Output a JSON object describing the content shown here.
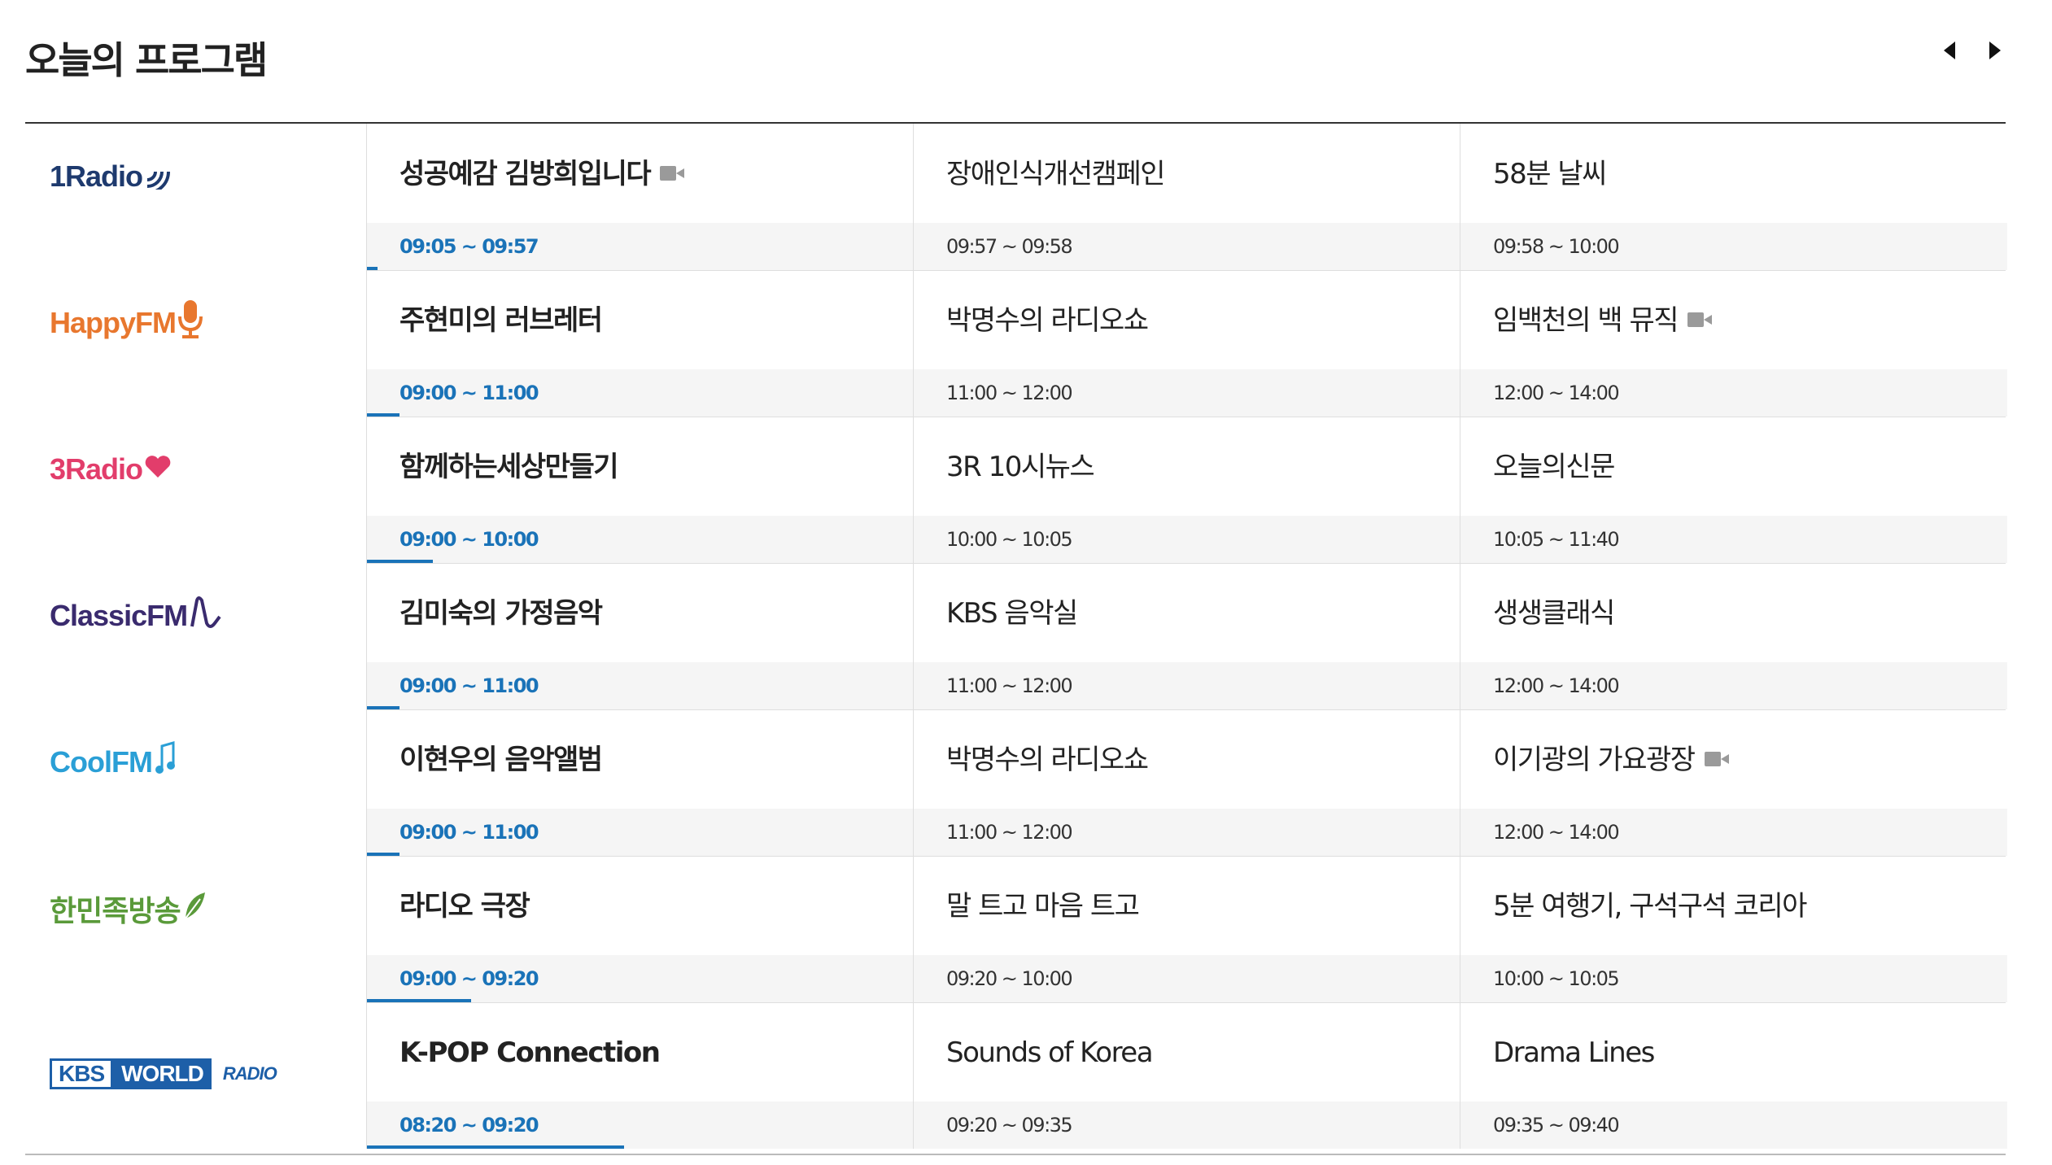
{
  "page": {
    "title": "오늘의 프로그램"
  },
  "nav": {
    "prev_icon": "caret-left-icon",
    "next_icon": "caret-right-icon"
  },
  "colors": {
    "accent": "#1a73b8",
    "divider": "#dedede",
    "timebar": "#f5f5f5"
  },
  "channels": [
    {
      "logo": {
        "main": "1Radio",
        "color": "#1e3a6e",
        "icon": "radio-wave-icon"
      },
      "programs": [
        {
          "name": "성공예감 김방희입니다",
          "time": "09:05 ~ 09:57",
          "video": true,
          "progress": 0.02
        },
        {
          "name": "장애인식개선캠페인",
          "time": "09:57 ~ 09:58",
          "video": false
        },
        {
          "name": "58분 날씨",
          "time": "09:58 ~ 10:00",
          "video": false
        }
      ]
    },
    {
      "logo": {
        "main": "HappyFM",
        "color": "#e8772e",
        "icon": "microphone-icon"
      },
      "programs": [
        {
          "name": "주현미의 러브레터",
          "time": "09:00 ~ 11:00",
          "video": false,
          "progress": 0.06
        },
        {
          "name": "박명수의 라디오쇼",
          "time": "11:00 ~ 12:00",
          "video": false
        },
        {
          "name": "임백천의 백 뮤직",
          "time": "12:00 ~ 14:00",
          "video": true
        }
      ]
    },
    {
      "logo": {
        "main": "3Radio",
        "color": "#e23d6b",
        "icon": "heart-icon"
      },
      "programs": [
        {
          "name": "함께하는세상만들기",
          "time": "09:00 ~ 10:00",
          "video": false,
          "progress": 0.12
        },
        {
          "name": "3R 10시뉴스",
          "time": "10:00 ~ 10:05",
          "video": false
        },
        {
          "name": "오늘의신문",
          "time": "10:05 ~ 11:40",
          "video": false
        }
      ]
    },
    {
      "logo": {
        "main": "ClassicFM",
        "color": "#3a2b6e",
        "icon": "music-wave-icon"
      },
      "programs": [
        {
          "name": "김미숙의 가정음악",
          "time": "09:00 ~ 11:00",
          "video": false,
          "progress": 0.06
        },
        {
          "name": "KBS 음악실",
          "time": "11:00 ~ 12:00",
          "video": false
        },
        {
          "name": "생생클래식",
          "time": "12:00 ~ 14:00",
          "video": false
        }
      ]
    },
    {
      "logo": {
        "main": "CoolFM",
        "color": "#2a9fd6",
        "icon": "music-note-icon"
      },
      "programs": [
        {
          "name": "이현우의 음악앨범",
          "time": "09:00 ~ 11:00",
          "video": false,
          "progress": 0.06
        },
        {
          "name": "박명수의 라디오쇼",
          "time": "11:00 ~ 12:00",
          "video": false
        },
        {
          "name": "이기광의 가요광장",
          "time": "12:00 ~ 14:00",
          "video": true
        }
      ]
    },
    {
      "logo": {
        "main": "한민족방송",
        "color": "#5a9a3a",
        "icon": "leaf-icon"
      },
      "programs": [
        {
          "name": "라디오 극장",
          "time": "09:00 ~ 09:20",
          "video": false,
          "progress": 0.19
        },
        {
          "name": "말 트고 마음 트고",
          "time": "09:20 ~ 10:00",
          "video": false
        },
        {
          "name": "5분 여행기, 구석구석 코리아",
          "time": "10:00 ~ 10:05",
          "video": false
        }
      ]
    },
    {
      "logo": {
        "main": "KBS",
        "second": "WORLD",
        "third": "RADIO",
        "color": "#1d5fa8",
        "icon": "kbs-world-logo-icon"
      },
      "programs": [
        {
          "name": "K-POP Connection",
          "time": "08:20 ~ 09:20",
          "video": false,
          "progress": 0.47
        },
        {
          "name": "Sounds of Korea",
          "time": "09:20 ~ 09:35",
          "video": false
        },
        {
          "name": "Drama Lines",
          "time": "09:35 ~ 09:40",
          "video": false
        }
      ]
    }
  ]
}
